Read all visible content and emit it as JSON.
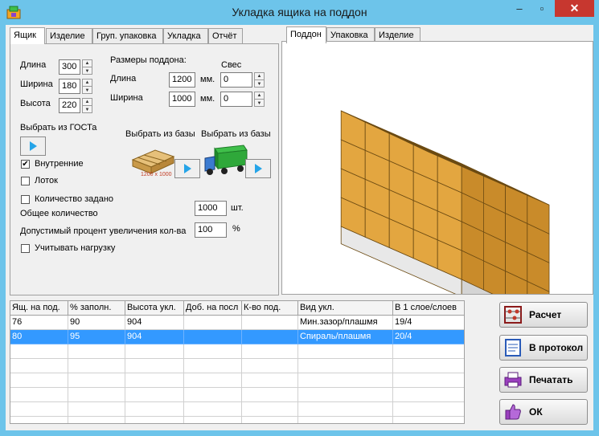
{
  "window": {
    "title": "Укладка ящика на поддон",
    "close_glyph": "✕",
    "max_glyph": "▫",
    "min_glyph": "–"
  },
  "left_tabs": [
    "Ящик",
    "Изделие",
    "Груп. упаковка",
    "Укладка",
    "Отчёт"
  ],
  "box": {
    "length_label": "Длина",
    "length": "300",
    "width_label": "Ширина",
    "width": "180",
    "height_label": "Высота",
    "height": "220"
  },
  "pallet": {
    "header": "Размеры поддона:",
    "overhang_header": "Свес",
    "length_label": "Длина",
    "length": "1200",
    "length_unit": "мм.",
    "length_overhang": "0",
    "width_label": "Ширина",
    "width": "1000",
    "width_unit": "мм.",
    "width_overhang": "0"
  },
  "gost_label": "Выбрать из ГОСТа",
  "db_label_1": "Выбрать из базы",
  "db_label_2": "Выбрать из базы",
  "pallet_image_caption": "1200 х 1000",
  "checkboxes": {
    "inner": {
      "label": "Внутренние",
      "checked": true
    },
    "tray": {
      "label": "Лоток",
      "checked": false
    },
    "qty_set": {
      "label": "Количество задано",
      "checked": false
    },
    "load": {
      "label": "Учитывать нагрузку",
      "checked": false
    }
  },
  "total_qty": {
    "label": "Общее количество",
    "value": "1000",
    "unit": "шт."
  },
  "increase_pct": {
    "label": "Допустимый процент увеличения кол-ва",
    "value": "100",
    "unit": "%"
  },
  "right_tabs": [
    "Поддон",
    "Упаковка",
    "Изделие"
  ],
  "table": {
    "columns": [
      "Ящ. на под.",
      "% заполн.",
      "Высота укл.",
      "Доб. на посл",
      "К-во под.",
      "Вид укл.",
      "В 1 слое/слоев"
    ],
    "rows": [
      [
        "76",
        "90",
        "904",
        "",
        "",
        "Мин.зазор/плашмя",
        "19/4"
      ],
      [
        "80",
        "95",
        "904",
        "",
        "",
        "Спираль/плашмя",
        "20/4"
      ]
    ],
    "selected_row": 1
  },
  "buttons": {
    "calc": "Расчет",
    "protocol": "В протокол",
    "print": "Печатать",
    "ok": "ОК"
  },
  "colors": {
    "titlebar": "#6dc4ea",
    "close": "#c7372f",
    "selection": "#3399ff",
    "box_top": "#f5c463",
    "box_left": "#e3a640",
    "box_right": "#c98b2a"
  }
}
